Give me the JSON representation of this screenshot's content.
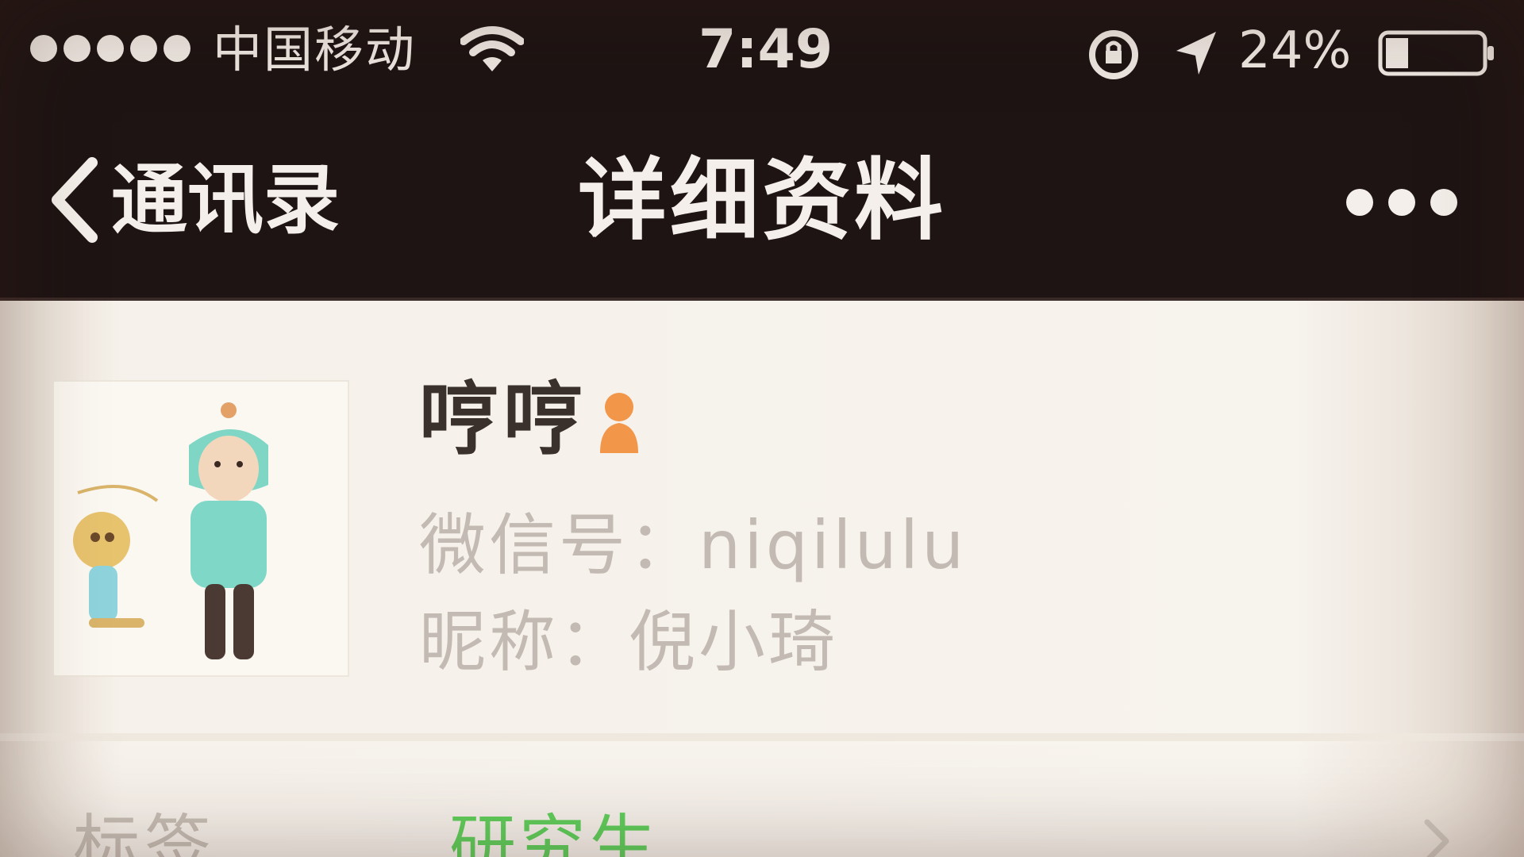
{
  "status_bar": {
    "carrier": "中国移动",
    "time": "7:49",
    "battery": "24%",
    "icons": [
      "signal-dots-icon",
      "wifi-icon",
      "lock-rotation-icon",
      "location-icon",
      "battery-icon"
    ]
  },
  "nav": {
    "back_label": "通讯录",
    "title": "详细资料",
    "more_icon": "more-icon"
  },
  "profile": {
    "name": "哼哼",
    "gender_icon": "female-icon",
    "wechat_id": "微信号：niqilulu",
    "nickname": "昵称：倪小琦"
  },
  "tag_row": {
    "label": "标签",
    "value": "研究生"
  },
  "colors": {
    "nav_bg": "#1d1413",
    "tag_green": "#5fd05c",
    "gender_orange": "#f2964a"
  }
}
